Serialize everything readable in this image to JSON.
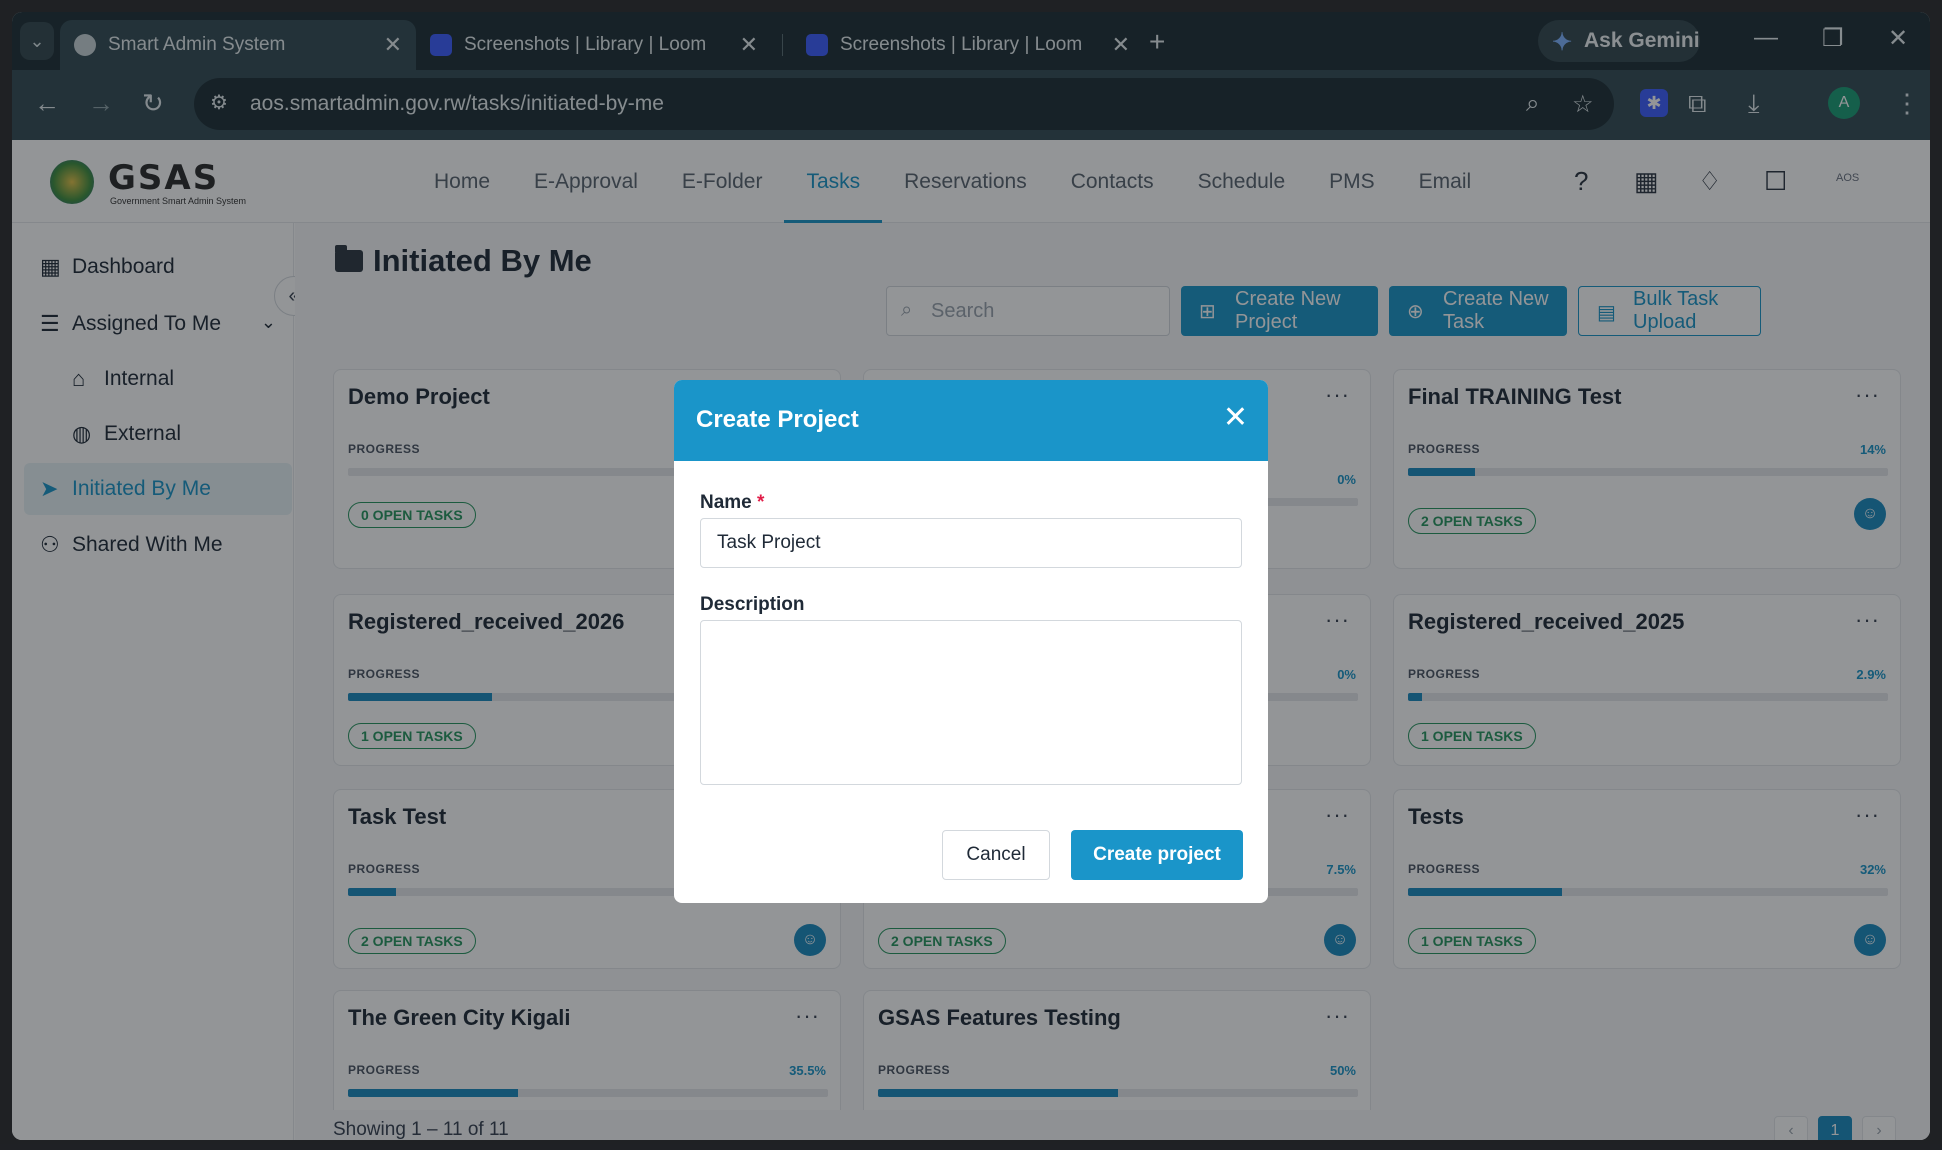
{
  "browser": {
    "tabs": [
      {
        "title": "Smart Admin System",
        "active": true
      },
      {
        "title": "Screenshots | Library | Loom",
        "active": false
      },
      {
        "title": "Screenshots | Library | Loom",
        "active": false
      }
    ],
    "gemini_label": "Ask Gemini",
    "url": "aos.smartadmin.gov.rw/tasks/initiated-by-me",
    "profile_initial": "A"
  },
  "app": {
    "logo_name": "GSAS",
    "logo_sub": "Government Smart Admin System",
    "nav": [
      "Home",
      "E-Approval",
      "E-Folder",
      "Tasks",
      "Reservations",
      "Contacts",
      "Schedule",
      "PMS",
      "Email"
    ],
    "nav_active": "Tasks",
    "user_tag": "AOS"
  },
  "sidebar": {
    "items": [
      {
        "label": "Dashboard"
      },
      {
        "label": "Assigned To Me"
      },
      {
        "label": "Internal"
      },
      {
        "label": "External"
      },
      {
        "label": "Initiated By Me"
      },
      {
        "label": "Shared With Me"
      }
    ]
  },
  "main": {
    "title": "Initiated By Me",
    "search_placeholder": "Search",
    "create_project_label": "Create New Project",
    "create_task_label": "Create New Task",
    "bulk_upload_label": "Bulk Task Upload",
    "progress_label": "PROGRESS",
    "cards": [
      {
        "title": "Demo Project",
        "pct": "",
        "progress": 0,
        "badge": "0 OPEN TASKS"
      },
      {
        "title": "",
        "pct": "0%",
        "progress": 0,
        "badge": ""
      },
      {
        "title": "Final TRAINING Test",
        "pct": "14%",
        "progress": 14,
        "badge": "2 OPEN TASKS"
      },
      {
        "title": "Registered_received_2026",
        "pct": "",
        "progress": 30,
        "badge": "1 OPEN TASKS"
      },
      {
        "title": "",
        "pct": "0%",
        "progress": 0,
        "badge": ""
      },
      {
        "title": "Registered_received_2025",
        "pct": "2.9%",
        "progress": 2.9,
        "badge": "1 OPEN TASKS"
      },
      {
        "title": "Task Test",
        "pct": "",
        "progress": 10,
        "badge": "2 OPEN TASKS"
      },
      {
        "title": "",
        "pct": "7.5%",
        "progress": 7.5,
        "badge": "2 OPEN TASKS"
      },
      {
        "title": "Tests",
        "pct": "32%",
        "progress": 32,
        "badge": "1 OPEN TASKS"
      },
      {
        "title": "The Green City Kigali",
        "pct": "35.5%",
        "progress": 35.5,
        "badge": ""
      },
      {
        "title": "GSAS Features Testing",
        "pct": "50%",
        "progress": 50,
        "badge": ""
      }
    ],
    "showing": "Showing 1 – 11 of 11",
    "current_page": "1"
  },
  "modal": {
    "title": "Create Project",
    "name_label": "Name",
    "required_mark": "*",
    "name_value": "Task Project",
    "description_label": "Description",
    "cancel_label": "Cancel",
    "submit_label": "Create project"
  },
  "colors": {
    "accent": "#1a95c9",
    "success": "#27955f"
  }
}
